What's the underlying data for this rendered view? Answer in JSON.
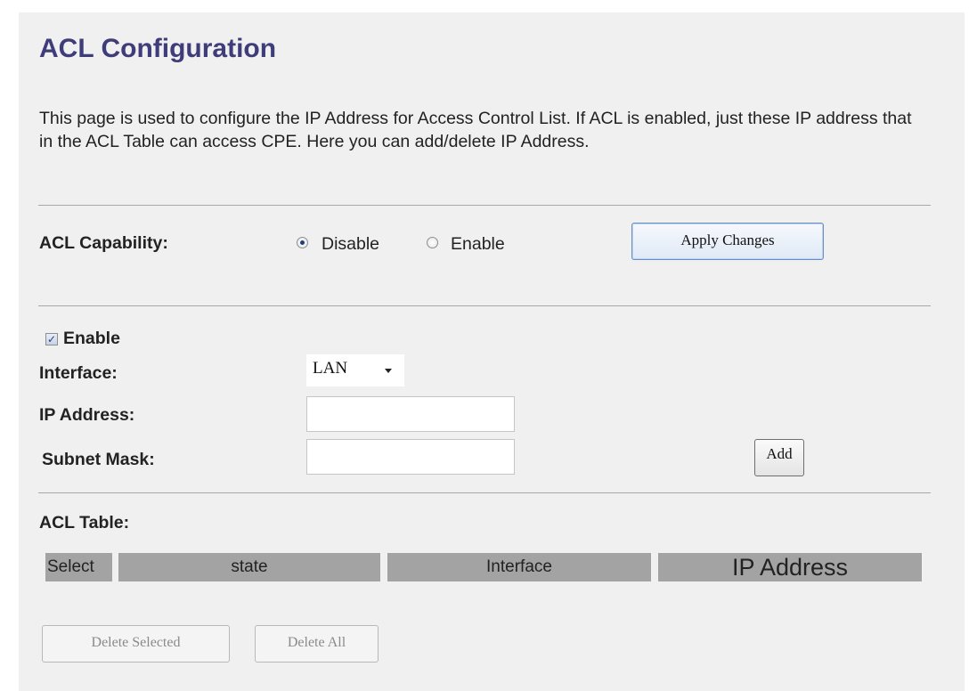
{
  "page": {
    "title": "ACL Configuration",
    "description": "This page is used to configure the IP Address for Access Control List. If ACL is enabled, just these IP address that in the ACL Table can access CPE. Here you can add/delete IP Address."
  },
  "capability": {
    "label": "ACL Capability:",
    "options": [
      "Disable",
      "Enable"
    ],
    "selected": "Disable",
    "apply_label": "Apply Changes"
  },
  "entry": {
    "enable_label": "Enable",
    "enable_checked": true,
    "interface_label": "Interface:",
    "interface_value": "LAN",
    "ip_label": "IP Address:",
    "ip_value": "",
    "mask_label": "Subnet Mask:",
    "mask_value": "",
    "add_label": "Add"
  },
  "table": {
    "label": "ACL Table:",
    "columns": [
      "Select",
      "state",
      "Interface",
      "IP Address"
    ],
    "rows": []
  },
  "actions": {
    "delete_selected_label": "Delete Selected",
    "delete_all_label": "Delete All"
  },
  "colors": {
    "title": "#3f3c7a",
    "panel_bg": "#f0f0f0",
    "table_header_bg": "#a3a3a3"
  }
}
